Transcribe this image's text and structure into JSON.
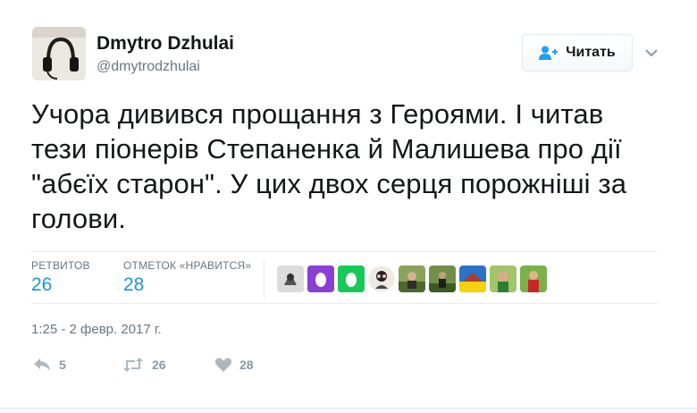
{
  "user": {
    "name": "Dmytro Dzhulai",
    "handle": "@dmytrodzhulai"
  },
  "follow_button": {
    "label": "Читать",
    "icon": "add-person-icon"
  },
  "tweet": {
    "text": "Учора дивився прощання з Героями. І читав тези піонерів Степаненка й Малишева про дії \"абєїх старон\". У цих двох серця порожніші за голови."
  },
  "stats": {
    "retweets_label": "РЕТВИТОВ",
    "retweets_count": "26",
    "likes_label": "ОТМЕТОК «НРАВИТСЯ»",
    "likes_count": "28"
  },
  "likers": [
    {
      "name": "liker-avatar-1"
    },
    {
      "name": "liker-avatar-2"
    },
    {
      "name": "liker-avatar-3"
    },
    {
      "name": "liker-avatar-4"
    },
    {
      "name": "liker-avatar-5"
    },
    {
      "name": "liker-avatar-6"
    },
    {
      "name": "liker-avatar-7"
    },
    {
      "name": "liker-avatar-8"
    },
    {
      "name": "liker-avatar-9"
    }
  ],
  "timestamp": "1:25 - 2 февр. 2017 г.",
  "actions": {
    "reply_count": "5",
    "retweet_count": "26",
    "like_count": "28"
  },
  "colors": {
    "accent": "#1b95e0",
    "muted": "#657786",
    "action_gray": "#8899a6"
  }
}
